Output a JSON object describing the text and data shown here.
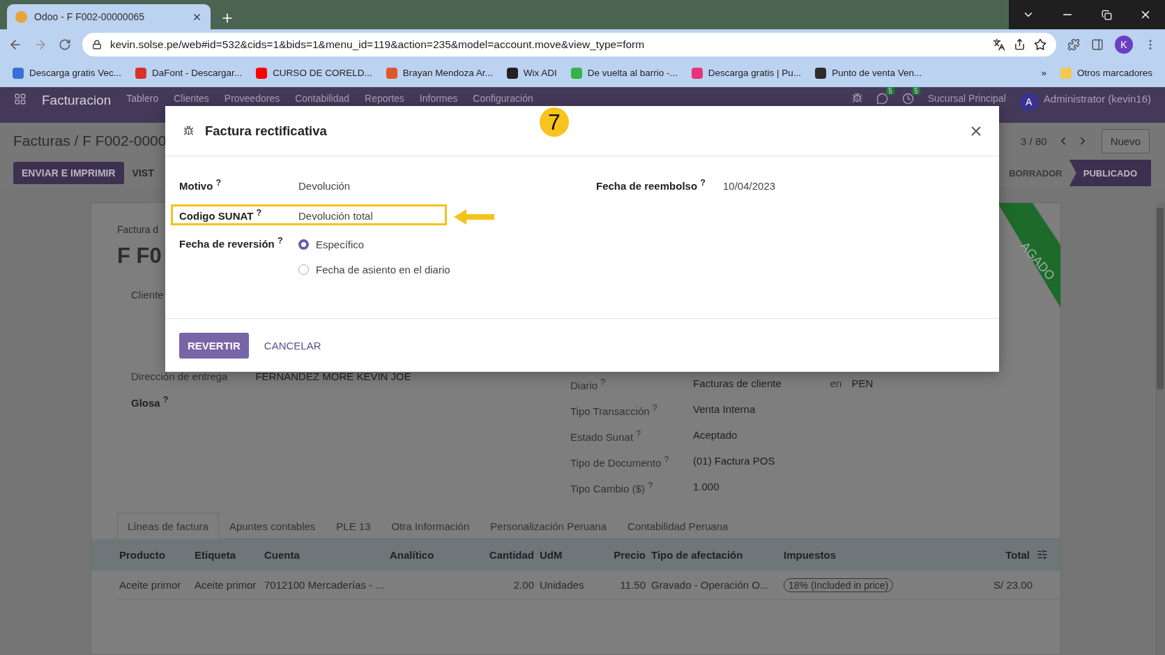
{
  "browser": {
    "tab_title": "Odoo - F F002-00000065",
    "url": "kevin.solse.pe/web#id=532&cids=1&bids=1&menu_id=119&action=235&model=account.move&view_type=form",
    "profile_initial": "K",
    "bookmarks": [
      {
        "label": "Descarga gratis Vec...",
        "color": "#3b6fd8"
      },
      {
        "label": "DaFont - Descargar...",
        "color": "#d9302c"
      },
      {
        "label": "CURSO DE CORELD...",
        "color": "#ff0000"
      },
      {
        "label": "Brayan Mendoza Ar...",
        "color": "#e2552a"
      },
      {
        "label": "Wix ADI",
        "color": "#222222"
      },
      {
        "label": "De vuelta al barrio -...",
        "color": "#35b34a"
      },
      {
        "label": "Descarga gratis | Pu...",
        "color": "#e8327a"
      },
      {
        "label": "Punto de venta Ven...",
        "color": "#2d2d2d"
      }
    ],
    "overflow": "»",
    "other_bookmarks": "Otros marcadores"
  },
  "navbar": {
    "app": "Facturacion",
    "menu": [
      "Tablero",
      "Clientes",
      "Proveedores",
      "Contabilidad",
      "Reportes",
      "Informes",
      "Configuración"
    ],
    "chat_badge": "5",
    "activity_badge": "5",
    "branch": "Sucursal Principal",
    "user_initial": "A",
    "user": "Administrator (kevin16)"
  },
  "control_panel": {
    "breadcrumb": "Facturas / F F002-0000",
    "pager": "3 / 80",
    "new_button": "Nuevo",
    "actions": [
      "ENVIAR E IMPRIMIR",
      "VIST"
    ],
    "statuses": [
      {
        "label": "BORRADOR",
        "selected": false
      },
      {
        "label": "PUBLICADO",
        "selected": true
      }
    ]
  },
  "sheet": {
    "subtitle": "Factura d",
    "title": "F F0",
    "customer_label": "Cliente",
    "stamp": "AGADO",
    "left_fields": [
      {
        "label": "Dirección de entrega",
        "value": "FERNANDEZ MORE KEVIN JOE"
      },
      {
        "label": "Glosa $^{?}$"
      }
    ],
    "right_fields": [
      {
        "label": "Diario $^{?}$",
        "value": "Facturas de cliente",
        "extra_label": "en",
        "extra_value": "PEN"
      },
      {
        "label": "Tipo Transacción $^{?}$",
        "value": "Venta Interna"
      },
      {
        "label": "Estado Sunat $^{?}$",
        "value": "Aceptado"
      },
      {
        "label": "Tipo de Documento $^{?}$",
        "value": "(01) Factura POS"
      },
      {
        "label": "Tipo Cambio ($) $^{?}$",
        "value": "1.000"
      }
    ],
    "tabs": [
      {
        "label": "Líneas de factura",
        "selected": true
      },
      {
        "label": "Apuntes contables",
        "selected": false
      },
      {
        "label": "PLE 13",
        "selected": false
      },
      {
        "label": "Otra Información",
        "selected": false
      },
      {
        "label": "Personalización Peruana",
        "selected": false
      },
      {
        "label": "Contabilidad Peruana",
        "selected": false
      }
    ],
    "table": {
      "columns": [
        "Producto",
        "Etiqueta",
        "Cuenta",
        "Analítico",
        "Cantidad",
        "UdM",
        "Precio",
        "Tipo de afectación",
        "Impuestos",
        "Total"
      ],
      "rows": [
        {
          "producto": "Aceite primor",
          "etiqueta": "Aceite primor",
          "cuenta": "7012100 Mercaderías - ...",
          "cantidad": "2.00",
          "udm": "Unidades",
          "precio": "11.50",
          "afectacion": "Gravado - Operación O...",
          "impuestos": "18% (Included in price)",
          "total": "S/ 23.00"
        }
      ]
    }
  },
  "dialog": {
    "title": "Factura rectificativa",
    "fields": [
      {
        "label": "Motivo $^{?}$",
        "value": "Devolución",
        "highlighted": false
      },
      {
        "label": "Codigo SUNAT $^{?}$",
        "value": "Devolución total",
        "highlighted": true
      }
    ],
    "date_field": {
      "label": "Fecha de reembolso $^{?}$",
      "value": "10/04/2023"
    },
    "reversal": {
      "label": "Fecha de reversión $^{?}$",
      "options": [
        {
          "label": "Específico",
          "selected": true
        },
        {
          "label": "Fecha de asiento en el diario",
          "selected": false
        }
      ]
    },
    "buttons": [
      "REVERTIR",
      "CANCELAR"
    ]
  },
  "annotation": {
    "step": "7"
  }
}
